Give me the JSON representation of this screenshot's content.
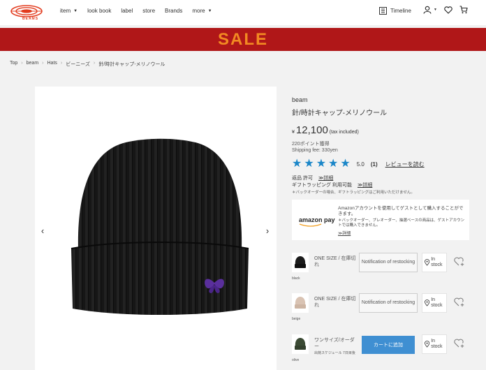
{
  "header": {
    "logo_text": "BEAMS",
    "nav": [
      {
        "label": "item",
        "has_caret": true
      },
      {
        "label": "look book",
        "has_caret": false
      },
      {
        "label": "label",
        "has_caret": false
      },
      {
        "label": "store",
        "has_caret": false
      },
      {
        "label": "Brands",
        "has_caret": false
      },
      {
        "label": "more",
        "has_caret": true
      }
    ],
    "timeline_label": "Timeline",
    "icons": [
      "timeline-icon",
      "user-icon",
      "heart-icon",
      "cart-icon"
    ]
  },
  "banner": {
    "text": "SALE",
    "bg_color": "#b01718",
    "text_color": "#f28a22"
  },
  "breadcrumb": [
    "Top",
    "beam",
    "Hats",
    "ビーニーズ",
    "針/時計キャップ-メリノウール"
  ],
  "product": {
    "brand": "beam",
    "name": "針/時計キャップ-メリノウール",
    "currency": "¥",
    "price": "12,100",
    "tax_note": "(tax included)",
    "points": "220ポイント獲得",
    "shipping": "Shipping fee: 330yen",
    "rating": {
      "score": "5.0",
      "count": "(1)",
      "stars": 5,
      "review_link": "レビューを読む"
    },
    "return_label": "返品 許可",
    "return_detail": "≫詳細",
    "gift_label": "ギフトラッピング 利用可能",
    "gift_detail": "≫詳細",
    "backorder_note": "＊バックオーダーの場合、ギフトラッピングはご利用いただけません。"
  },
  "amazon_pay": {
    "logo": "amazon pay",
    "description": "Amazonアカウントを使用してゲストとして購入することができます。",
    "sub": "＊バックオーダー、プレオーダー、抽選ベースの商品は、ゲストアカウントでは購入できません。",
    "detail": "≫詳細"
  },
  "variants": [
    {
      "swatch": "black",
      "swatch_color": "#1b1b1b",
      "name": "ONE SIZE / 在庫切れ",
      "action": "Notification of restocking",
      "action_type": "notify",
      "stock": "In stock"
    },
    {
      "swatch": "beige",
      "swatch_color": "#d9c3b3",
      "name": "ONE SIZE / 在庫切れ",
      "action": "Notification of restocking",
      "action_type": "notify",
      "stock": "In stock"
    },
    {
      "swatch": "olive",
      "swatch_color": "#3b4a34",
      "name": "ワンサイズ/オーダー",
      "subnote": "出荷スケジュール 7日目後",
      "action": "カートに追加",
      "action_type": "cart",
      "stock": "In stock"
    }
  ],
  "colors": {
    "accent_blue": "#3f8fd2",
    "star_blue": "#1a86c8",
    "butterfly_purple": "#5a2f9c"
  }
}
